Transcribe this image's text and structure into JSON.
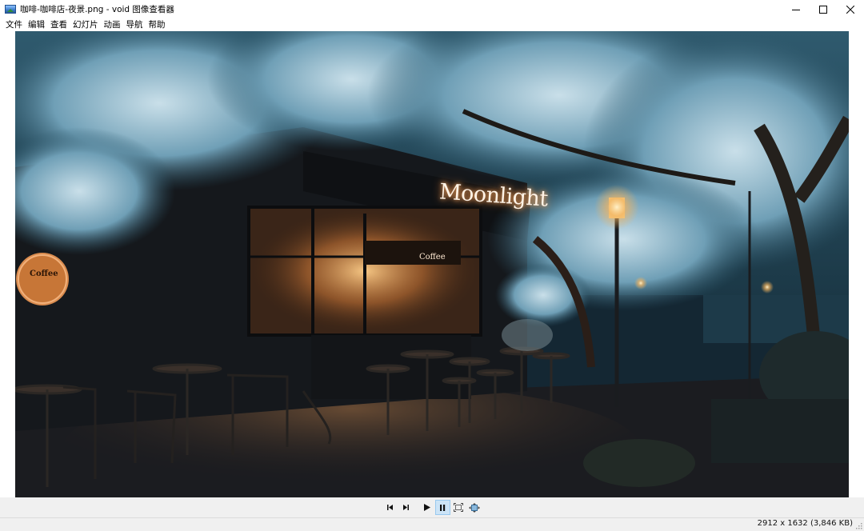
{
  "window": {
    "title": "咖啡-咖啡店-夜景.png - void 图像查看器",
    "minimize_icon": "minimize-icon",
    "maximize_icon": "maximize-icon",
    "close_icon": "close-icon"
  },
  "menu": {
    "items": [
      "文件",
      "编辑",
      "查看",
      "幻灯片",
      "动画",
      "导航",
      "帮助"
    ]
  },
  "image": {
    "shop_sign": "Moonlight",
    "wall_sign": "Coffee",
    "board_text": "Coffee"
  },
  "toolbar": {
    "buttons": [
      "previous-icon",
      "next-icon",
      "play-icon",
      "pause-icon",
      "fit-window-icon",
      "actual-size-icon"
    ],
    "active": "pause-icon"
  },
  "status": {
    "info": "2912 x 1632 (3,846 KB)"
  },
  "colors": {
    "accent": "#cce4f7",
    "accent_border": "#99c9ef"
  }
}
